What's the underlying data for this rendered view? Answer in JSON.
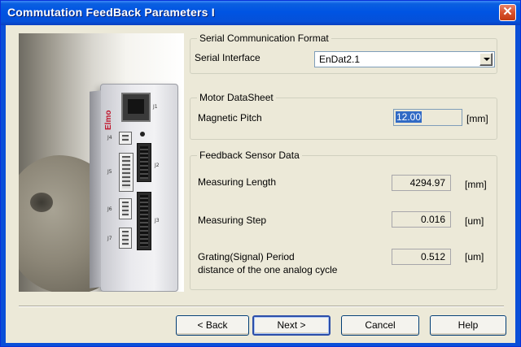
{
  "window": {
    "title": "Commutation FeedBack Parameters I",
    "close_glyph": "✕"
  },
  "picture": {
    "brand": "Elmo",
    "connector_labels": [
      "J1",
      "J4",
      "J5",
      "J2",
      "J6",
      "J3",
      "J7"
    ]
  },
  "serial": {
    "legend": "Serial Communication Format",
    "interface_label": "Serial Interface",
    "interface_value": "EnDat2.1"
  },
  "motor": {
    "legend": "Motor DataSheet",
    "magnetic_pitch_label": "Magnetic Pitch",
    "magnetic_pitch_value": "12.00",
    "magnetic_pitch_unit": "[mm]"
  },
  "feedback": {
    "legend": "Feedback Sensor Data",
    "measuring_length_label": "Measuring Length",
    "measuring_length_value": "4294.97",
    "measuring_length_unit": "[mm]",
    "measuring_step_label": "Measuring Step",
    "measuring_step_value": "0.016",
    "measuring_step_unit": "[um]",
    "grating_label": "Grating(Signal) Period",
    "grating_sublabel": "distance of the one analog cycle",
    "grating_value": "0.512",
    "grating_unit": "[um]"
  },
  "buttons": {
    "back": "< Back",
    "next": "Next >",
    "cancel": "Cancel",
    "help": "Help"
  },
  "colors": {
    "titlebar": "#0054e3",
    "dialog_bg": "#ece9d8",
    "selection": "#316ac5",
    "brand_red": "#c0172d"
  },
  "icons": {
    "close": "close-icon",
    "dropdown": "chevron-down-icon"
  }
}
